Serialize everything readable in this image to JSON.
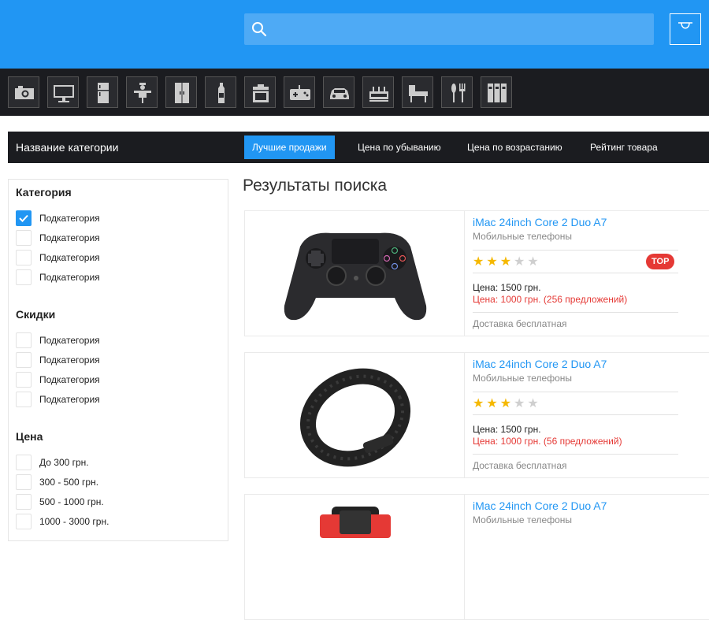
{
  "header": {
    "search_placeholder": "",
    "search_value": ""
  },
  "category_icons": [
    "camera-icon",
    "monitor-icon",
    "fridge-icon",
    "scarecrow-icon",
    "wardrobe-icon",
    "bottle-icon",
    "stove-icon",
    "gamepad-icon",
    "car-icon",
    "tabletop-icon",
    "piano-icon",
    "cutlery-icon",
    "binders-icon"
  ],
  "sortbar": {
    "title": "Название категории",
    "options": [
      "Лучшие продажи",
      "Цена по убыванию",
      "Цена по возрастанию",
      "Рейтинг товара"
    ],
    "active_index": 0
  },
  "filters": [
    {
      "title": "Категория",
      "items": [
        {
          "label": "Подкатегория",
          "checked": true
        },
        {
          "label": "Подкатегория",
          "checked": false
        },
        {
          "label": "Подкатегория",
          "checked": false
        },
        {
          "label": "Подкатегория",
          "checked": false
        }
      ]
    },
    {
      "title": "Скидки",
      "items": [
        {
          "label": "Подкатегория",
          "checked": false
        },
        {
          "label": "Подкатегория",
          "checked": false
        },
        {
          "label": "Подкатегория",
          "checked": false
        },
        {
          "label": "Подкатегория",
          "checked": false
        }
      ]
    },
    {
      "title": "Цена",
      "items": [
        {
          "label": "До 300 грн.",
          "checked": false
        },
        {
          "label": "300 - 500 грн.",
          "checked": false
        },
        {
          "label": "500 - 1000 грн.",
          "checked": false
        },
        {
          "label": "1000 - 3000 грн.",
          "checked": false
        }
      ]
    }
  ],
  "results": {
    "title": "Результаты поиска",
    "products": [
      {
        "image": "gamepad-image",
        "name": "iMac 24inch Core 2 Duo A7",
        "category": "Мобильные телефоны",
        "rating": 3,
        "max_rating": 5,
        "badge": "TOP",
        "price": "Цена: 1500 грн.",
        "offer": "Цена: 1000 грн. (256 предложений)",
        "delivery": "Доставка бесплатная"
      },
      {
        "image": "fitness-band-image",
        "name": "iMac 24inch Core 2 Duo A7",
        "category": "Мобильные телефоны",
        "rating": 3,
        "max_rating": 5,
        "badge": "",
        "price": "Цена: 1500 грн.",
        "offer": "Цена: 1000 грн. (56 предложений)",
        "delivery": "Доставка бесплатная"
      },
      {
        "image": "watch-image",
        "name": "iMac 24inch Core 2 Duo A7",
        "category": "Мобильные телефоны",
        "rating": 3,
        "max_rating": 5,
        "badge": "",
        "price": "",
        "offer": "",
        "delivery": ""
      }
    ]
  },
  "colors": {
    "accent": "#2196f3",
    "header_bg": "#2196f3",
    "dark_bar": "#1b1c20",
    "sale_red": "#e53935",
    "star": "#f5b800"
  }
}
